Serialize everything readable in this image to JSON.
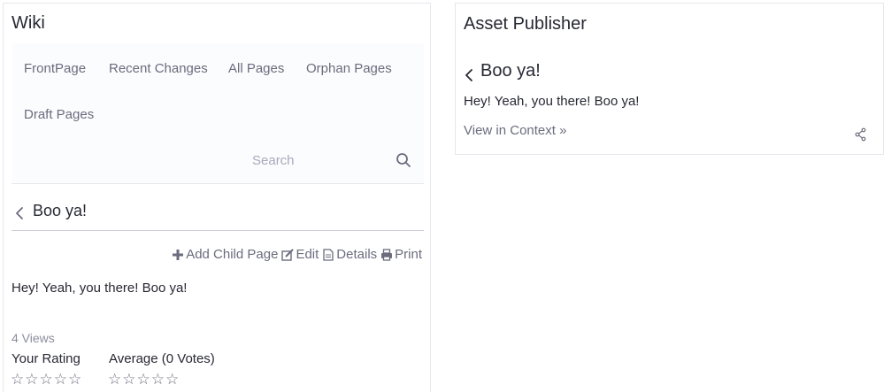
{
  "wiki": {
    "title": "Wiki",
    "nav": [
      "FrontPage",
      "Recent Changes",
      "All Pages",
      "Orphan Pages",
      "Draft Pages"
    ],
    "search": {
      "placeholder": "Search",
      "value": ""
    },
    "page": {
      "title": "Boo ya!",
      "actions": {
        "add_child": "Add Child Page",
        "edit": "Edit",
        "details": "Details",
        "print": "Print"
      },
      "content": "Hey! Yeah, you there! Boo ya!",
      "views": "4 Views",
      "your_rating": "Your Rating",
      "average": "Average (0 Votes)"
    }
  },
  "asset_publisher": {
    "title": "Asset Publisher",
    "entry_title": "Boo ya!",
    "summary": "Hey! Yeah, you there! Boo ya!",
    "view_in_context": "View in Context »"
  }
}
